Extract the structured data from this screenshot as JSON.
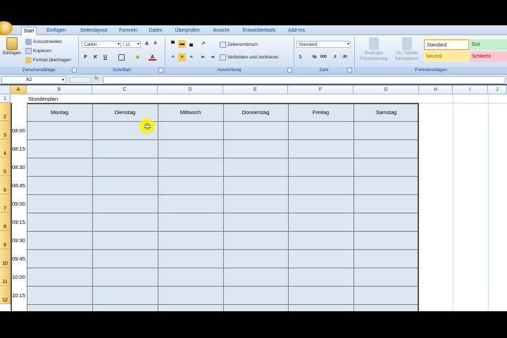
{
  "tabs": [
    "Start",
    "Einfügen",
    "Seitenlayout",
    "Formeln",
    "Daten",
    "Überprüfen",
    "Ansicht",
    "Entwicklertools",
    "Add-Ins"
  ],
  "active_tab": "Start",
  "clipboard": {
    "paste": "Einfügen",
    "cut": "Ausschneiden",
    "copy": "Kopieren",
    "format_painter": "Format übertragen",
    "group": "Zwischenablage"
  },
  "font": {
    "name": "Calibri",
    "size": "11",
    "bold": "F",
    "italic": "K",
    "underline": "U",
    "group": "Schriftart"
  },
  "alignment": {
    "wrap": "Zeilenumbruch",
    "merge": "Verbinden und zentrieren",
    "group": "Ausrichtung"
  },
  "number": {
    "format": "Standard",
    "percent": "%",
    "thousands": "000",
    "group": "Zahl"
  },
  "styles": {
    "conditional": "Bedingte Formatierung",
    "as_table": "Als Tabelle formatieren",
    "cell_standard": "Standard",
    "cell_good": "Gut",
    "cell_neutral": "Neutral",
    "cell_bad": "Schlecht",
    "group": "Formatvorlagen"
  },
  "formula_bar": {
    "name_box": "A2",
    "fx": "fx"
  },
  "columns": [
    "A",
    "B",
    "C",
    "D",
    "E",
    "F",
    "G",
    "H",
    "I",
    "J"
  ],
  "rows": [
    "1",
    "2",
    "3",
    "4",
    "5",
    "6",
    "7",
    "8",
    "9",
    "10",
    "11",
    "12"
  ],
  "sheet": {
    "title": "Stundenplan",
    "days": [
      "Montag",
      "Dienstag",
      "Mittwoch",
      "Donnerstag",
      "Freitag",
      "Samstag"
    ],
    "times": [
      "08:00",
      "08:15",
      "08:30",
      "08:45",
      "09:00",
      "09:15",
      "09:30",
      "09:45",
      "10:00",
      "10:15"
    ]
  },
  "colors": {
    "ribbon_blue": "#c6d9f1",
    "table_fill": "#dce6f1",
    "selected_header": "#f7c65c",
    "cursor_highlight": "#ffee00",
    "good_fill": "#c6efce",
    "neutral_fill": "#ffeb9c",
    "bad_fill": "#ffc7ce"
  }
}
